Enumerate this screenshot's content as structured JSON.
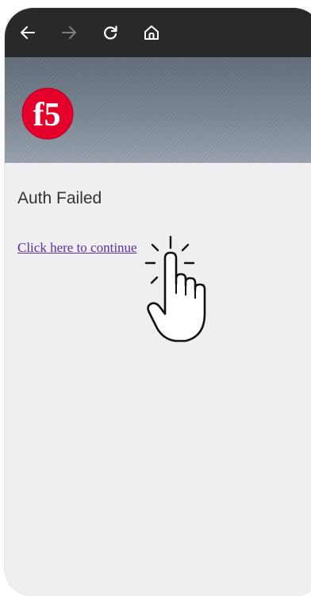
{
  "toolbar": {
    "icons": [
      "back-arrow-icon",
      "forward-arrow-icon",
      "reload-icon",
      "home-icon"
    ]
  },
  "header": {
    "logo_text": "f5",
    "brand_color": "#e4002b"
  },
  "main": {
    "heading": "Auth Failed",
    "link_label": "Click here to continue",
    "link_color": "#5a2fa3"
  },
  "overlay": {
    "cursor": "pointer-hand-click-icon"
  }
}
